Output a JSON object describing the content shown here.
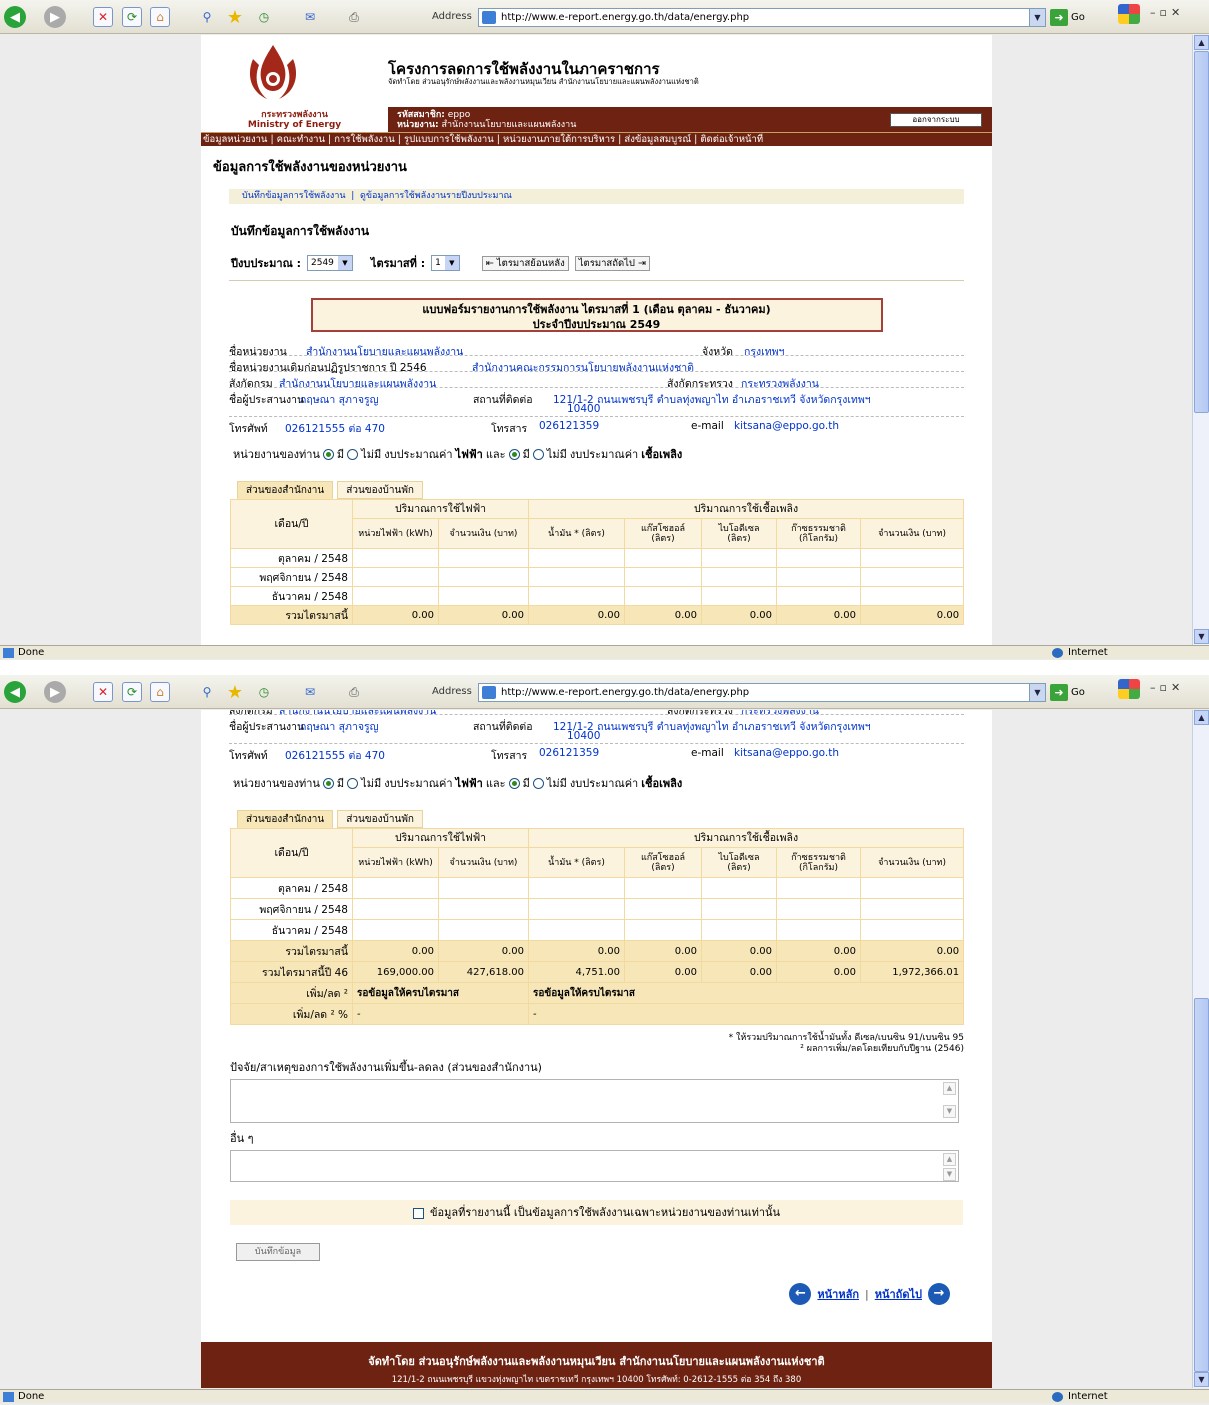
{
  "browser": {
    "address_label": "Address",
    "url": "http://www.e-report.energy.go.th/data/energy.php",
    "go_label": "Go",
    "status_done": "Done",
    "status_zone": "Internet"
  },
  "header": {
    "title": "โครงการลดการใช้พลังงานในภาคราชการ",
    "subtitle": "จัดทำโดย ส่วนอนุรักษ์พลังงานและพลังงานหมุนเวียน สำนักงานนโยบายและแผนพลังงานแห่งชาติ",
    "ministry_th": "กระทรวงพลังงาน",
    "ministry_en": "Ministry of Energy",
    "member_label": "รหัสสมาชิก:",
    "member_value": "eppo",
    "agency_label": "หน่วยงาน:",
    "agency_value": "สำนักงานนโยบายและแผนพลังงาน",
    "logout": "ออกจากระบบ"
  },
  "menu": {
    "items": [
      "ข้อมูลหน่วยงาน",
      "คณะทำงาน",
      "การใช้พลังงาน",
      "รูปแบบการใช้พลังงาน",
      "หน่วยงานภายใต้การบริหาร",
      "ส่งข้อมูลสมบูรณ์",
      "ติดต่อเจ้าหน้าที่"
    ]
  },
  "main": {
    "title": "ข้อมูลการใช้พลังงานของหน่วยงาน",
    "subnav": [
      "บันทึกข้อมูลการใช้พลังงาน",
      "ดูข้อมูลการใช้พลังงานรายปีงบประมาณ"
    ],
    "section_title": "บันทึกข้อมูลการใช้พลังงาน",
    "year_label": "ปีงบประมาณ :",
    "year_value": "2549",
    "quarter_label": "ไตรมาสที่ :",
    "quarter_value": "1",
    "prev_quarter": "ไตรมาสย้อนหลัง",
    "next_quarter": "ไตรมาสถัดไป",
    "form_title_1": "แบบฟอร์มรายงานการใช้พลังงาน ไตรมาสที่ 1    (เดือน ตุลาคม - ธันวาคม)",
    "form_title_2": "ประจำปีงบประมาณ  2549"
  },
  "info": {
    "agency_label": "ชื่อหน่วยงาน",
    "agency_value": "สำนักงานนโยบายและแผนพลังงาน",
    "province_label": "จังหวัด",
    "province_value": "กรุงเทพฯ",
    "old_name_label": "ชื่อหน่วยงานเดิมก่อนปฏิรูปราชการ ปี 2546",
    "old_name_value": "สำนักงานคณะกรรมการนโยบายพลังงานแห่งชาติ",
    "dept_label": "สังกัดกรม",
    "dept_value": "สำนักงานนโยบายและแผนพลังงาน",
    "ministry_label": "สังกัดกระทรวง",
    "ministry_value": "กระทรวงพลังงาน",
    "coord_label": "ชื่อผู้ประสานงาน",
    "coord_value": "กฤษณา สุภาจรูญ",
    "address_label": "สถานที่ติดต่อ",
    "address_value_1": "121/1-2 ถนนเพชรบุรี ตำบลทุ่งพญาไท อำเภอราชเทวี จังหวัดกรุงเทพฯ",
    "address_value_2": "10400",
    "phone_label": "โทรศัพท์",
    "phone_value": "026121555 ต่อ 470",
    "fax_label": "โทรสาร",
    "fax_value": "026121359",
    "email_label": "e-mail",
    "email_value": "kitsana@eppo.go.th"
  },
  "budget": {
    "prefix": "หน่วยงานของท่าน",
    "yes": "มี",
    "no": "ไม่มี",
    "elec_text": "งบประมาณค่า",
    "elec_bold": "ไฟฟ้า",
    "and": "และ",
    "fuel_text": "งบประมาณค่า",
    "fuel_bold": "เชื้อเพลิง"
  },
  "tabs": [
    "ส่วนของสำนักงาน",
    "ส่วนของบ้านพัก"
  ],
  "table": {
    "month_header": "เดือน/ปี",
    "elec_group": "ปริมาณการใช้ไฟฟ้า",
    "fuel_group": "ปริมาณการใช้เชื้อเพลิง",
    "cols": [
      "หน่วยไฟฟ้า (kWh)",
      "จำนวนเงิน (บาท)",
      "น้ำมัน * (ลิตร)",
      "แก๊สโซฮอล์ (ลิตร)",
      "ไบโอดีเซล (ลิตร)",
      "ก๊าซธรรมชาติ (กิโลกรัม)",
      "จำนวนเงิน (บาท)"
    ],
    "months": [
      "ตุลาคม / 2548",
      "พฤศจิกายน / 2548",
      "ธันวาคม / 2548"
    ],
    "sum_label": "รวมไตรมาสนี้",
    "sum_values": [
      "0.00",
      "0.00",
      "0.00",
      "0.00",
      "0.00",
      "0.00",
      "0.00"
    ],
    "base_label": "รวมไตรมาสนี้ปี 46",
    "base_values": [
      "169,000.00",
      "427,618.00",
      "4,751.00",
      "0.00",
      "0.00",
      "0.00",
      "1,972,366.01"
    ],
    "diff_label": "เพิ่ม/ลด",
    "diff_pct_label": "เพิ่ม/ลด",
    "pending_text": "รอข้อมูลให้ครบไตรมาส",
    "dash": "-"
  },
  "notes": {
    "note1": "* ให้รวมปริมาณการใช้น้ำมันทั้ง ดีเซล/เบนซิน 91/เบนซิน 95",
    "note2": "ผลการเพิ่ม/ลดโดยเทียบกับปีฐาน (2546)"
  },
  "form": {
    "reason_label": "ปัจจัย/สาเหตุของการใช้พลังงานเพิ่มขึ้น-ลดลง (ส่วนของสำนักงาน)",
    "other_label": "อื่น ๆ",
    "confirm_text": "ข้อมูลที่รายงานนี้ เป็นข้อมูลการใช้พลังงานเฉพาะหน่วยงานของท่านเท่านั้น",
    "save_button": "บันทึกข้อมูล",
    "home_link": "หน้าหลัก",
    "next_link": "หน้าถัดไป"
  },
  "footer": {
    "line1": "จัดทำโดย ส่วนอนุรักษ์พลังงานและพลังงานหมุนเวียน สำนักงานนโยบายและแผนพลังงานแห่งชาติ",
    "line2": "121/1-2 ถนนเพชรบุรี แขวงทุ่งพญาไท เขตราชเทวี กรุงเทพฯ 10400  โทรศัพท์: 0-2612-1555 ต่อ 354 ถึง 380"
  }
}
